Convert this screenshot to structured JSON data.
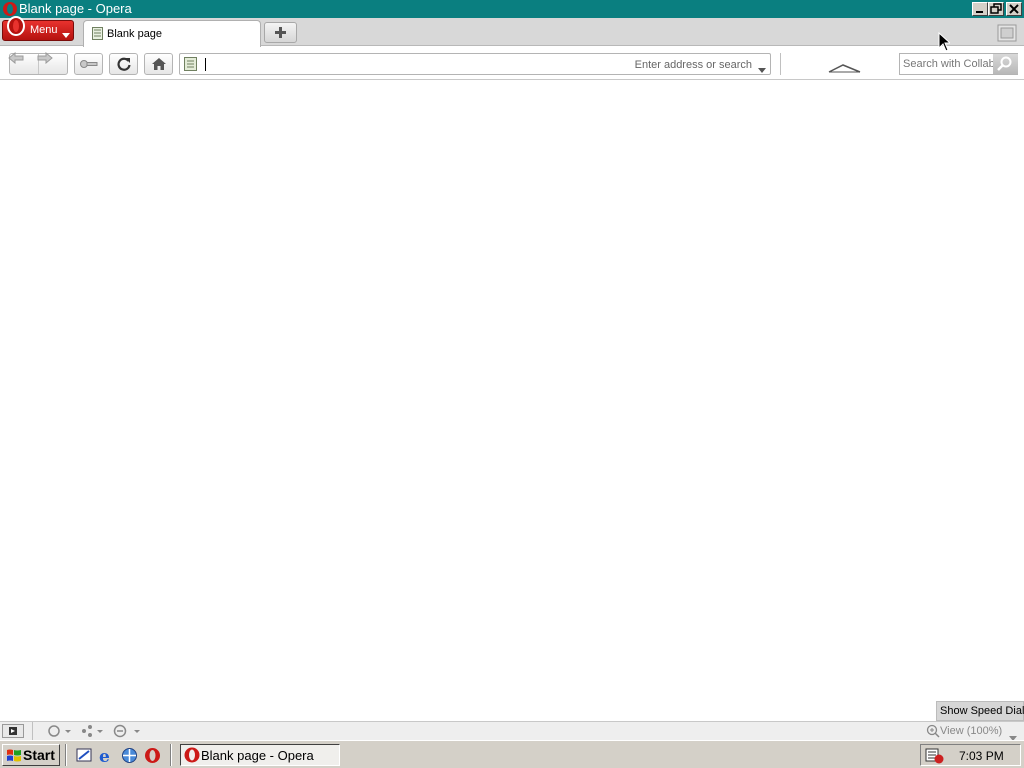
{
  "window": {
    "title": "Blank page - Opera"
  },
  "tabstrip": {
    "menu_label": "Menu",
    "tabs": [
      {
        "label": "Blank page"
      }
    ]
  },
  "navbar": {
    "address_value": "",
    "address_placeholder": "Enter address or search",
    "search_placeholder": "Search with Collab"
  },
  "content": {
    "speed_dial_label": "Show Speed Dial"
  },
  "statusbar": {
    "zoom_label": "View (100%)"
  },
  "taskbar": {
    "start_label": "Start",
    "tasks": [
      {
        "label": "Blank page - Opera"
      }
    ],
    "clock": "7:03 PM"
  },
  "colors": {
    "titlebar": "#0a7f80",
    "opera_red": "#cc1a17",
    "taskbar": "#d4d0c8"
  }
}
